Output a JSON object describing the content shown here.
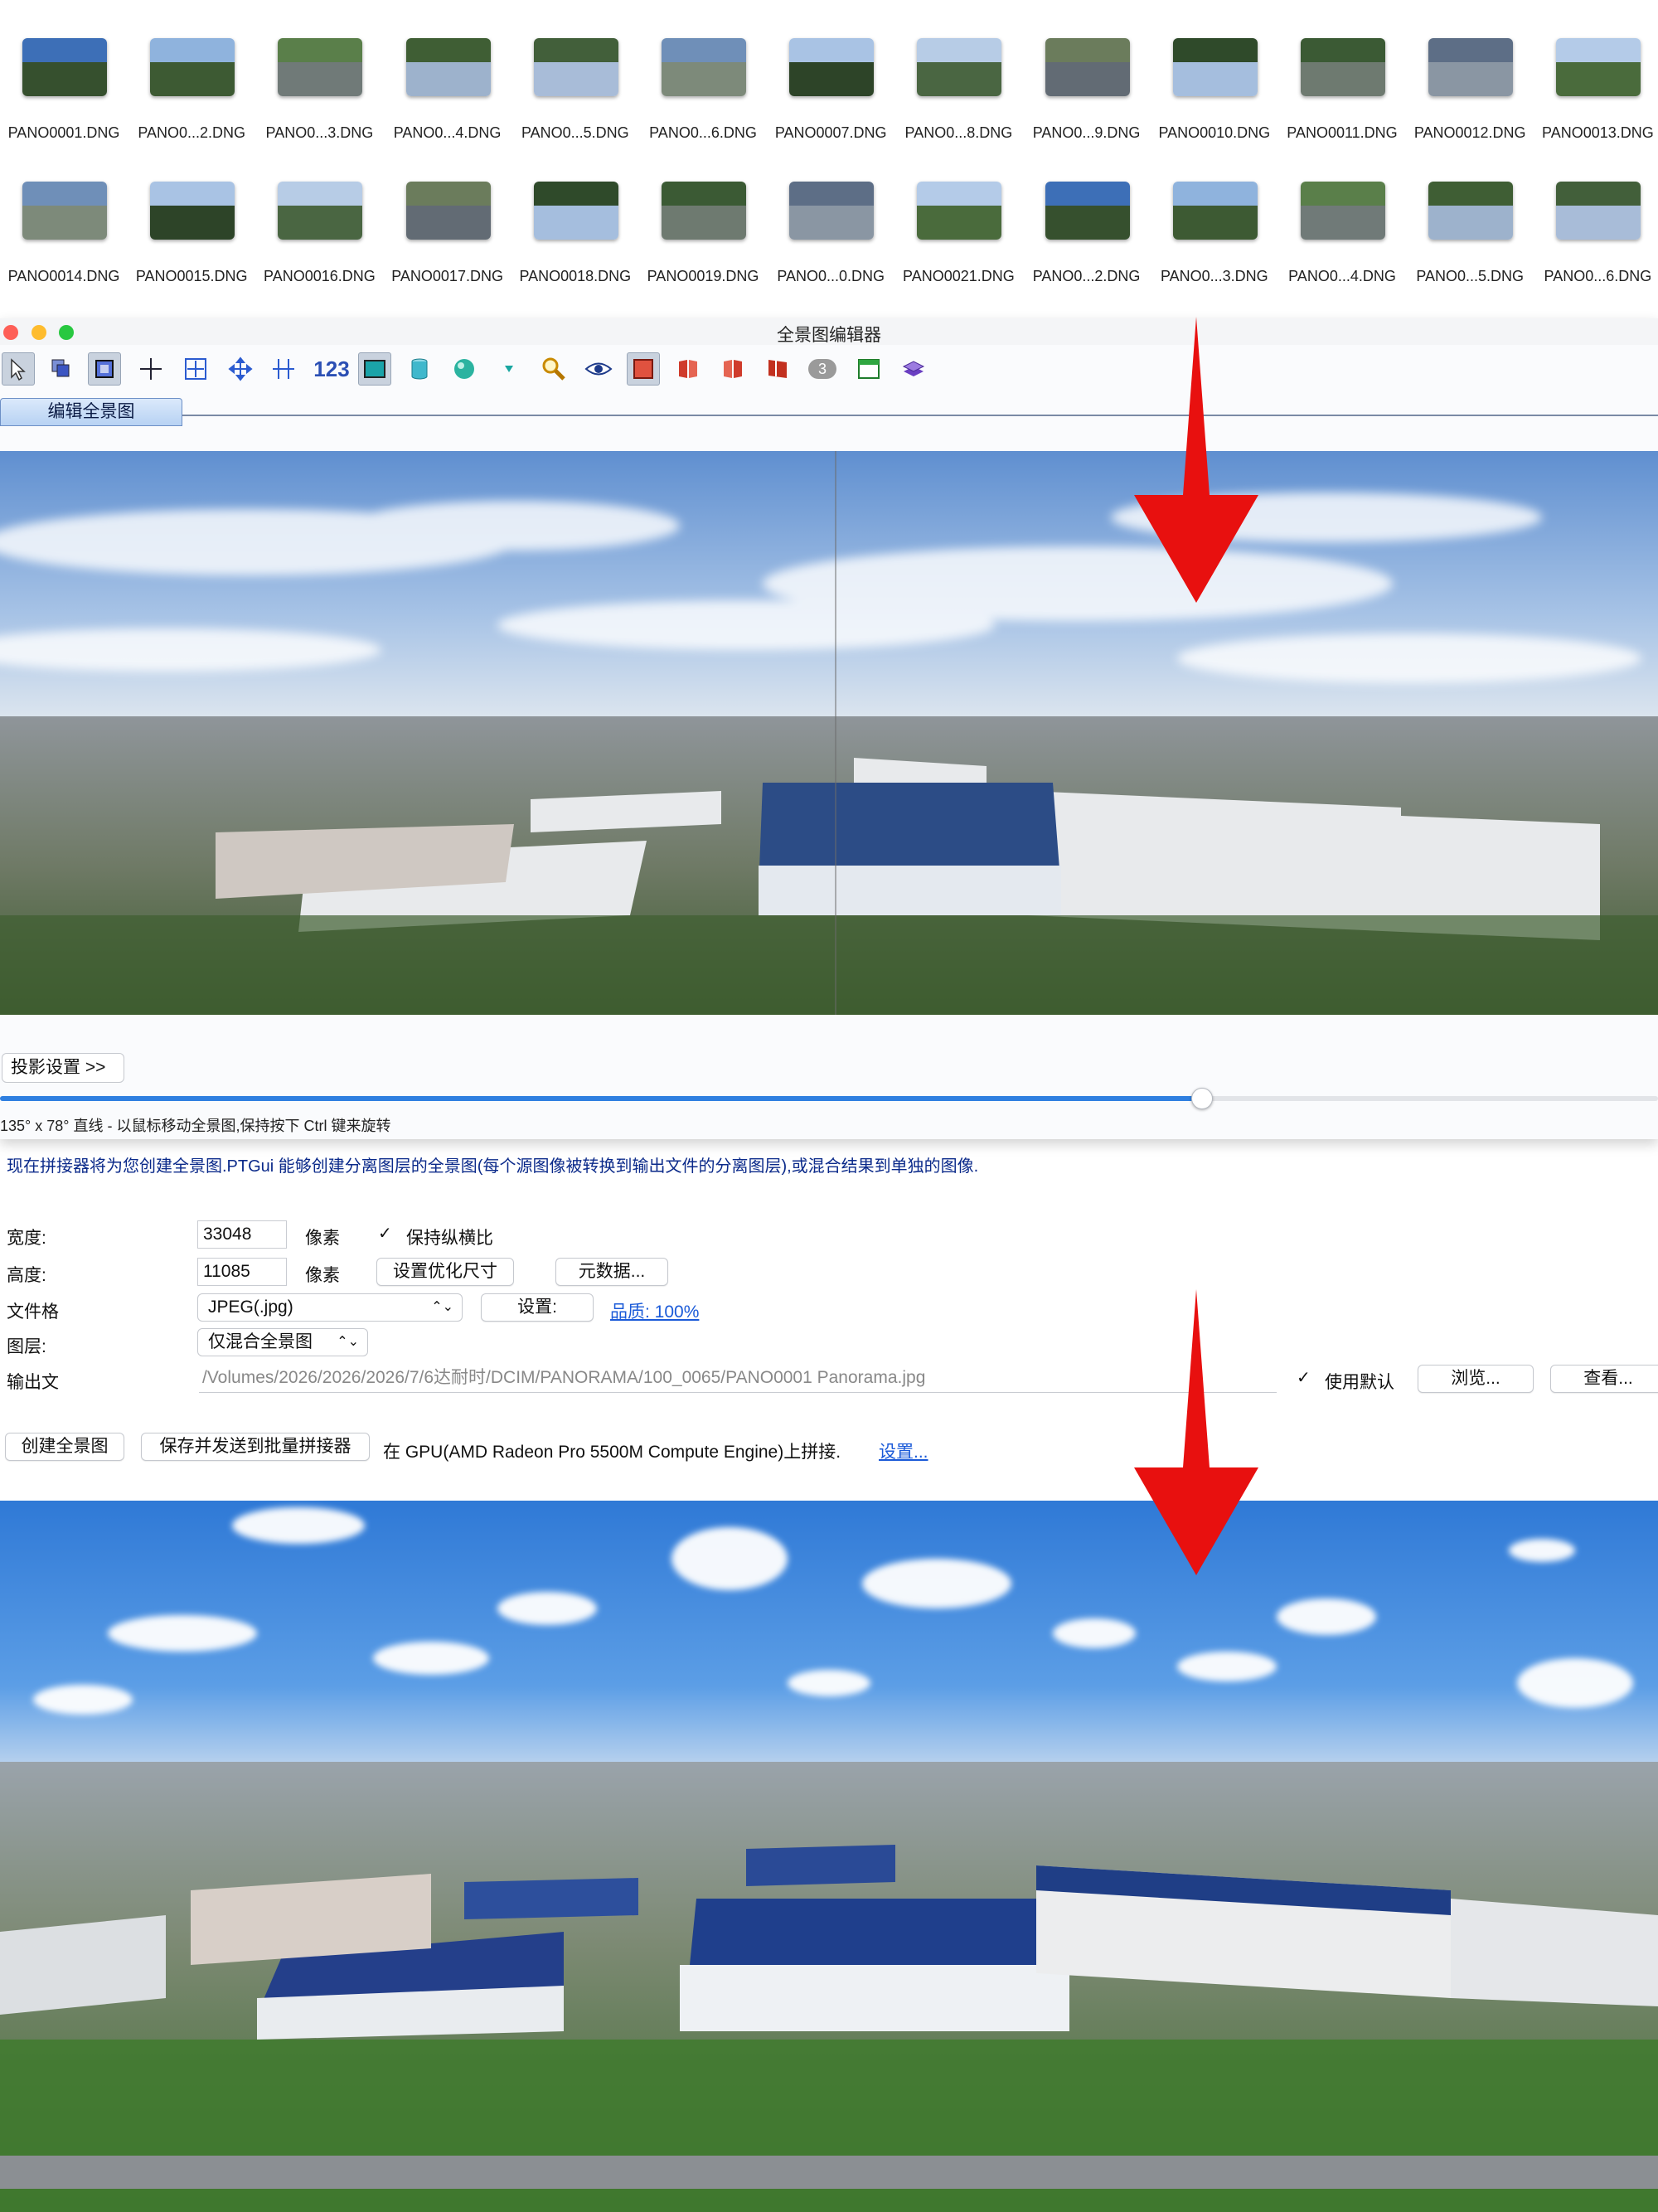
{
  "thumbnails": {
    "row1": [
      "PANO0001.DNG",
      "PANO0...2.DNG",
      "PANO0...3.DNG",
      "PANO0...4.DNG",
      "PANO0...5.DNG",
      "PANO0...6.DNG",
      "PANO0007.DNG",
      "PANO0...8.DNG",
      "PANO0...9.DNG",
      "PANO0010.DNG",
      "PANO0011.DNG",
      "PANO0012.DNG",
      "PANO0013.DNG"
    ],
    "row2": [
      "PANO0014.DNG",
      "PANO0015.DNG",
      "PANO0016.DNG",
      "PANO0017.DNG",
      "PANO0018.DNG",
      "PANO0019.DNG",
      "PANO0...0.DNG",
      "PANO0021.DNG",
      "PANO0...2.DNG",
      "PANO0...3.DNG",
      "PANO0...4.DNG",
      "PANO0...5.DNG",
      "PANO0...6.DNG"
    ]
  },
  "editor": {
    "title": "全景图编辑器",
    "tab_label": "编辑全景图",
    "toolbar_icons": [
      "select-arrow-icon",
      "layers-icon",
      "crop-icon",
      "center-point-icon",
      "fit-icon",
      "move-icon",
      "straighten-icon",
      "numeric-transform-icon",
      "rectangle-view-icon",
      "cylinder-icon",
      "sphere-icon",
      "dropdown-triangle-icon",
      "zoom-icon",
      "eye-icon",
      "red-frame-icon",
      "red-book-icon",
      "red-page-icon",
      "red-flag-icon",
      "number-3-badge-icon",
      "window-icon",
      "stack-icon"
    ],
    "toolbar_numeric_label": "123",
    "toolbar_badge_label": "3",
    "projection_button": "投影设置 >>",
    "slider_value_percent": 72.5,
    "status_text": "135° x 78° 直线 - 以鼠标移动全景图,保持按下 Ctrl 键来旋转",
    "colors": {
      "slider": "#2f7fe0",
      "tab": "#b7d2f3",
      "close": "#fe5f57",
      "minimize": "#febc2e",
      "zoom": "#28c840"
    }
  },
  "stitcher": {
    "info_text": "现在拼接器将为您创建全景图.PTGui 能够创建分离图层的全景图(每个源图像被转换到输出文件的分离图层),或混合结果到单独的图像.",
    "width_label": "宽度:",
    "width_value": "33048",
    "height_label": "高度:",
    "height_value": "11085",
    "pixel_unit": "像素",
    "keep_ratio_label": "保持纵横比",
    "keep_ratio_checked": true,
    "optimize_size_button": "设置优化尺寸",
    "metadata_button": "元数据...",
    "file_format_label": "文件格",
    "file_format_value": "JPEG(.jpg)",
    "settings_button": "设置:",
    "quality_link": "品质: 100%",
    "layers_label": "图层:",
    "layers_value": "仅混合全景图",
    "output_label": "输出文",
    "output_path": "/Volumes/2026/2026/2026/7/6达耐时/DCIM/PANORAMA/100_0065/PANO0001 Panorama.jpg",
    "use_default_label": "使用默认",
    "use_default_checked": true,
    "browse_button": "浏览...",
    "view_button": "查看...",
    "create_button": "创建全景图",
    "save_batch_button": "保存并发送到批量拼接器",
    "gpu_text": "在 GPU(AMD Radeon Pro 5500M Compute Engine)上拼接.",
    "gpu_settings_link": "设置..."
  },
  "arrow_color": "#e8100f"
}
